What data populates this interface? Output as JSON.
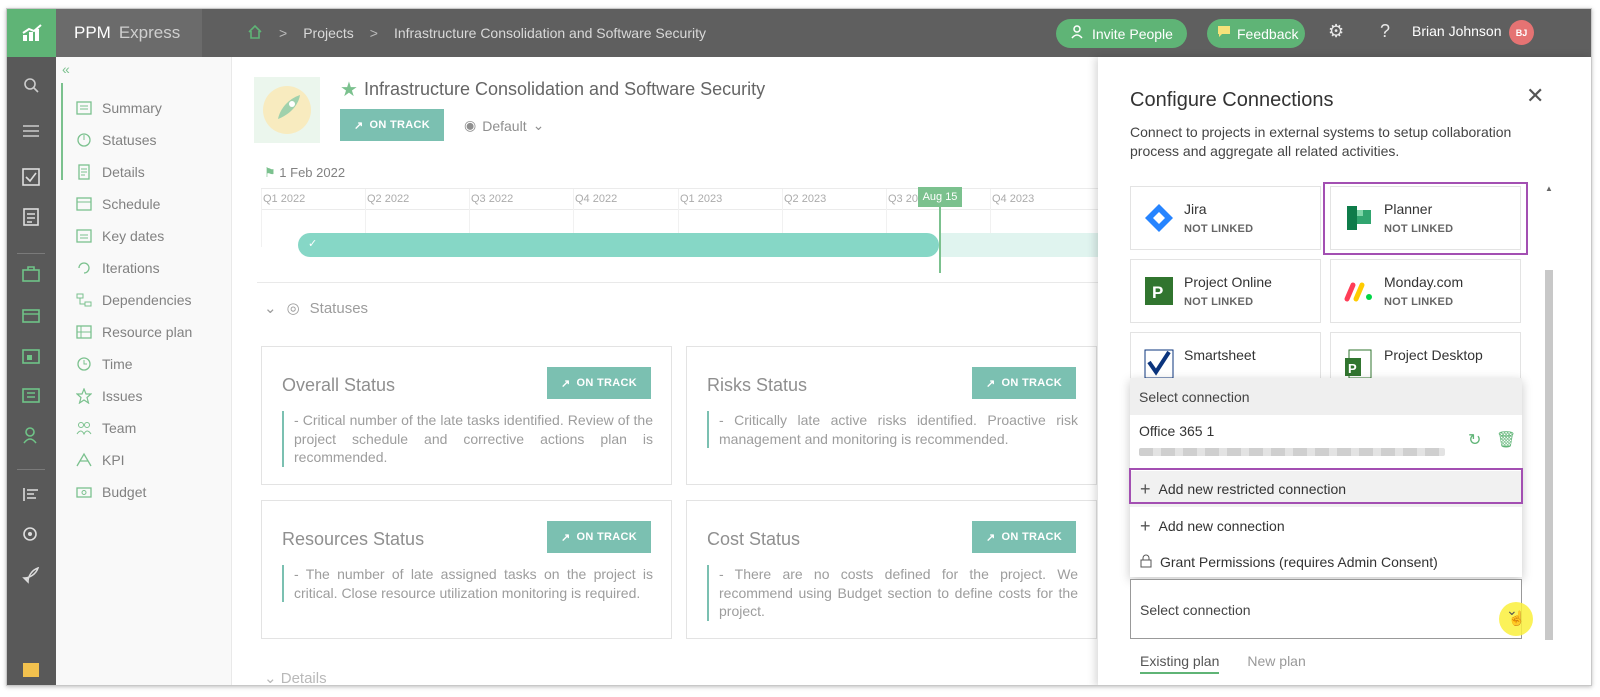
{
  "app": {
    "brand": "PPM",
    "brand_sub": "Express"
  },
  "breadcrumb": {
    "projects": "Projects",
    "project": "Infrastructure Consolidation and Software Security"
  },
  "header": {
    "invite_label": "Invite People",
    "feedback_label": "Feedback",
    "user_name": "Brian Johnson",
    "user_initials": "BJ",
    "settings_icon": "gear-icon",
    "help_icon": "help-icon"
  },
  "nav": {
    "collapse": "«",
    "items": [
      {
        "label": "Summary",
        "icon": "summary-icon"
      },
      {
        "label": "Statuses",
        "icon": "statuses-icon"
      },
      {
        "label": "Details",
        "icon": "details-icon"
      },
      {
        "label": "Schedule",
        "icon": "schedule-icon"
      },
      {
        "label": "Key dates",
        "icon": "key-dates-icon"
      },
      {
        "label": "Iterations",
        "icon": "iterations-icon"
      },
      {
        "label": "Dependencies",
        "icon": "dependencies-icon"
      },
      {
        "label": "Resource plan",
        "icon": "resource-plan-icon"
      },
      {
        "label": "Time",
        "icon": "time-icon"
      },
      {
        "label": "Issues",
        "icon": "issues-icon"
      },
      {
        "label": "Team",
        "icon": "team-icon"
      },
      {
        "label": "KPI",
        "icon": "kpi-icon"
      },
      {
        "label": "Budget",
        "icon": "budget-icon"
      }
    ]
  },
  "project": {
    "title": "Infrastructure Consolidation and Software Security",
    "status": "ON TRACK",
    "view": "Default",
    "start_date": "1 Feb 2022"
  },
  "timeline": {
    "quarters": [
      "Q1 2022",
      "Q2 2022",
      "Q3 2022",
      "Q4 2022",
      "Q1 2023",
      "Q2 2023",
      "Q3 20",
      "Q4 2023"
    ],
    "today_label": "Aug 15",
    "progress": 0.8
  },
  "statuses": {
    "section_label": "Statuses",
    "cards": [
      {
        "title": "Overall Status",
        "badge": "ON TRACK",
        "text": "- Critical number of the late tasks identified. Review of the project schedule and corrective actions plan is recommended."
      },
      {
        "title": "Risks Status",
        "badge": "ON TRACK",
        "text": "- Critically late active risks identified. Proactive risk management and monitoring is recommended."
      },
      {
        "title": "Resources Status",
        "badge": "ON TRACK",
        "text": "- The number of late assigned tasks on the project is critical. Close resource utilization monitoring is required."
      },
      {
        "title": "Cost Status",
        "badge": "ON TRACK",
        "text": "- There are no costs defined for the project. We recommend using Budget section to define costs for the project."
      }
    ],
    "next_section": "Details"
  },
  "panel": {
    "title": "Configure Connections",
    "description": "Connect to projects in external systems to setup collaboration process and aggregate all related activities.",
    "tiles": [
      {
        "name": "Jira",
        "status": "NOT LINKED"
      },
      {
        "name": "Planner",
        "status": "NOT LINKED"
      },
      {
        "name": "Project Online",
        "status": "NOT LINKED"
      },
      {
        "name": "Monday.com",
        "status": "NOT LINKED"
      },
      {
        "name": "Smartsheet",
        "status": ""
      },
      {
        "name": "Project Desktop",
        "status": ""
      }
    ],
    "dropdown": {
      "header": "Select connection",
      "connection_name": "Office 365 1",
      "items": [
        "Add new restricted connection",
        "Add new connection",
        "Grant Permissions (requires Admin Consent)"
      ]
    },
    "select_placeholder": "Select connection",
    "tabs": [
      "Existing plan",
      "New plan"
    ],
    "highlight_color": "#a34fb2",
    "accent": "#5fb476"
  }
}
